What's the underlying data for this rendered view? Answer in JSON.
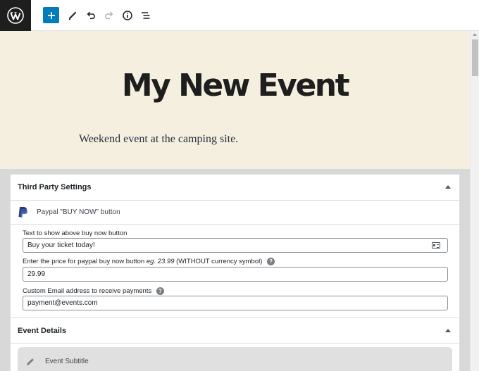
{
  "toolbar": {
    "logo_icon": "wordpress-logo",
    "add_block_icon": "plus-icon",
    "tools_icon": "pencil-icon",
    "undo_icon": "undo-icon",
    "redo_icon": "redo-icon",
    "details_icon": "info-icon",
    "outline_icon": "list-view-icon"
  },
  "post": {
    "title": "My New Event",
    "excerpt": "Weekend event at the camping site."
  },
  "third_party": {
    "heading": "Third Party Settings",
    "paypal_label": "Paypal \"BUY NOW\" button",
    "text_label": "Text to show above buy now button",
    "text_value": "Buy your ticket today!",
    "price_label_prefix": "Enter the price for paypal buy now button",
    "price_label_example": "eg. 23.99",
    "price_label_suffix": "(WITHOUT currency symbol)",
    "price_value": "29.99",
    "email_label": "Custom Email address to receive payments",
    "email_value": "payment@events.com",
    "help_glyph": "?"
  },
  "event_details": {
    "heading": "Event Details",
    "subtitle_label": "Event Subtitle"
  },
  "colors": {
    "accent": "#007cba",
    "title_bg": "#f5efe0",
    "logo_bg": "#1e1e1e"
  }
}
